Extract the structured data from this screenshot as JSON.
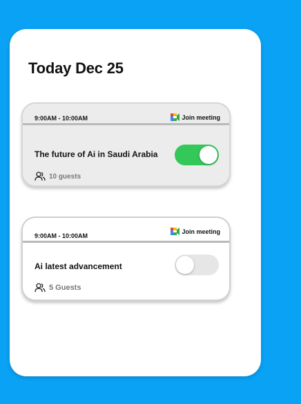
{
  "header": {
    "title": "Today Dec 25"
  },
  "events": [
    {
      "time": "9:00AM - 10:00AM",
      "join_label": "Join meeting",
      "title": "The future of Ai in Saudi Arabia",
      "guests": "10 guests",
      "enabled": true
    },
    {
      "time": "9:00AM - 10:00AM",
      "join_label": "Join meeting",
      "title": "Ai latest advancement",
      "guests": "5 Guests",
      "enabled": false
    }
  ],
  "colors": {
    "background": "#0aa2f5",
    "toggle_on": "#34c759",
    "toggle_off": "#e6e6e6"
  },
  "icons": {
    "join": "google-meet-icon",
    "guests": "people-icon"
  }
}
